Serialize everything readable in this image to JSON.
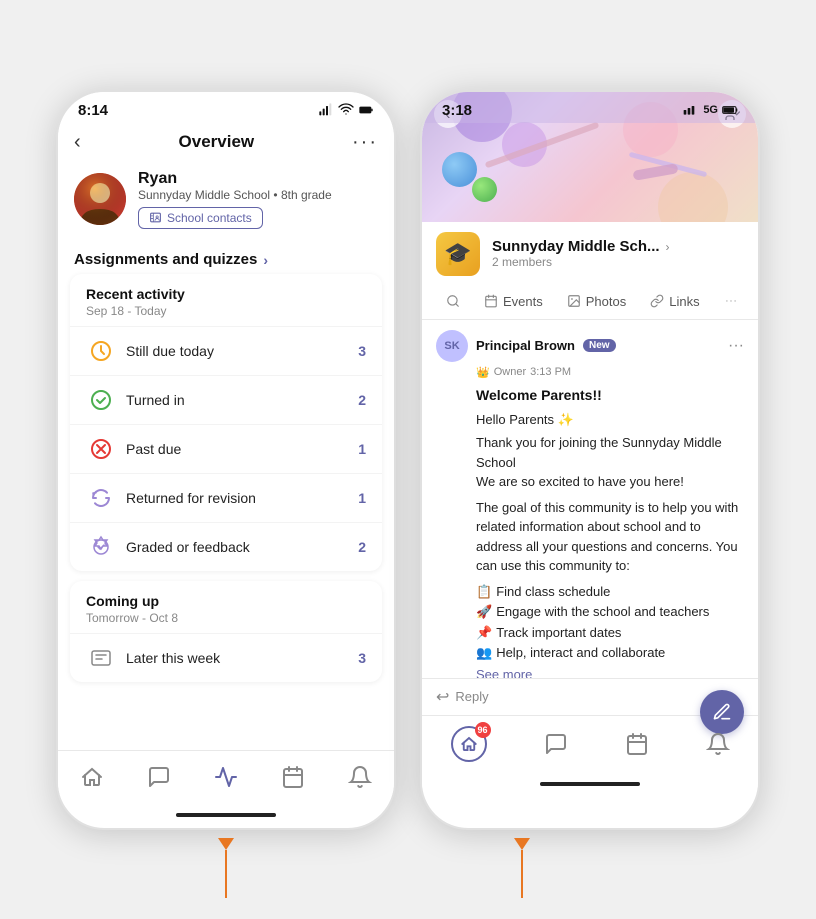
{
  "left_phone": {
    "status_bar": {
      "time": "8:14"
    },
    "nav": {
      "title": "Overview",
      "back": "‹",
      "more": "···"
    },
    "profile": {
      "name": "Ryan",
      "school": "Sunnyday Middle School • 8th grade",
      "contacts_btn": "School contacts"
    },
    "assignments_header": "Assignments and quizzes",
    "recent_activity": {
      "title": "Recent activity",
      "subtitle": "Sep 18 - Today",
      "items": [
        {
          "label": "Still due today",
          "count": "3",
          "icon": "clock"
        },
        {
          "label": "Turned in",
          "count": "2",
          "icon": "check"
        },
        {
          "label": "Past due",
          "count": "1",
          "icon": "x-circle"
        },
        {
          "label": "Returned for revision",
          "count": "1",
          "icon": "refresh"
        },
        {
          "label": "Graded or feedback",
          "count": "2",
          "icon": "badge-check"
        }
      ]
    },
    "coming_up": {
      "title": "Coming up",
      "subtitle": "Tomorrow - Oct 8",
      "items": [
        {
          "label": "Later this week",
          "count": "3",
          "icon": "list"
        }
      ]
    },
    "bottom_nav": [
      {
        "name": "Home",
        "icon": "home"
      },
      {
        "name": "Chat",
        "icon": "chat"
      },
      {
        "name": "Activity",
        "icon": "activity",
        "active": true
      },
      {
        "name": "Calendar",
        "icon": "calendar"
      },
      {
        "name": "Bell",
        "icon": "bell"
      }
    ]
  },
  "right_phone": {
    "status_bar": {
      "time": "3:18",
      "network": "5G"
    },
    "group": {
      "name": "Sunnyday Middle Sch...",
      "name_chevron": "›",
      "members": "2 members",
      "icon": "🎓"
    },
    "tabs": [
      {
        "label": "Search",
        "icon": "🔍",
        "active": false
      },
      {
        "label": "Events",
        "icon": "📅",
        "active": false
      },
      {
        "label": "Photos",
        "icon": "🖼️",
        "active": false
      },
      {
        "label": "Links",
        "icon": "🔗",
        "active": false
      }
    ],
    "message": {
      "author_initials": "SK",
      "author_name": "Principal Brown",
      "badge": "New",
      "role": "Owner",
      "time": "3:13 PM",
      "title": "Welcome Parents!!",
      "greeting": "Hello Parents ✨",
      "intro": "Thank you for joining the Sunnyday Middle School\nWe are so excited to have you here!",
      "body": "The goal of this community is to help you with related information about school and to address all your questions and concerns. You can use this community to:",
      "list": [
        {
          "emoji": "📋",
          "text": "Find class schedule"
        },
        {
          "emoji": "🚀",
          "text": "Engage with the school and teachers"
        },
        {
          "emoji": "📌",
          "text": "Track important dates"
        },
        {
          "emoji": "👥",
          "text": "Help, interact and collaborate"
        }
      ],
      "see_more": "See more"
    },
    "reply_label": "Reply",
    "fab_icon": "✏️",
    "bottom_nav": [
      {
        "name": "Home",
        "badge": "96",
        "active": false
      },
      {
        "name": "Chat",
        "active": false
      },
      {
        "name": "Calendar",
        "active": false
      },
      {
        "name": "Bell",
        "active": false
      }
    ]
  }
}
